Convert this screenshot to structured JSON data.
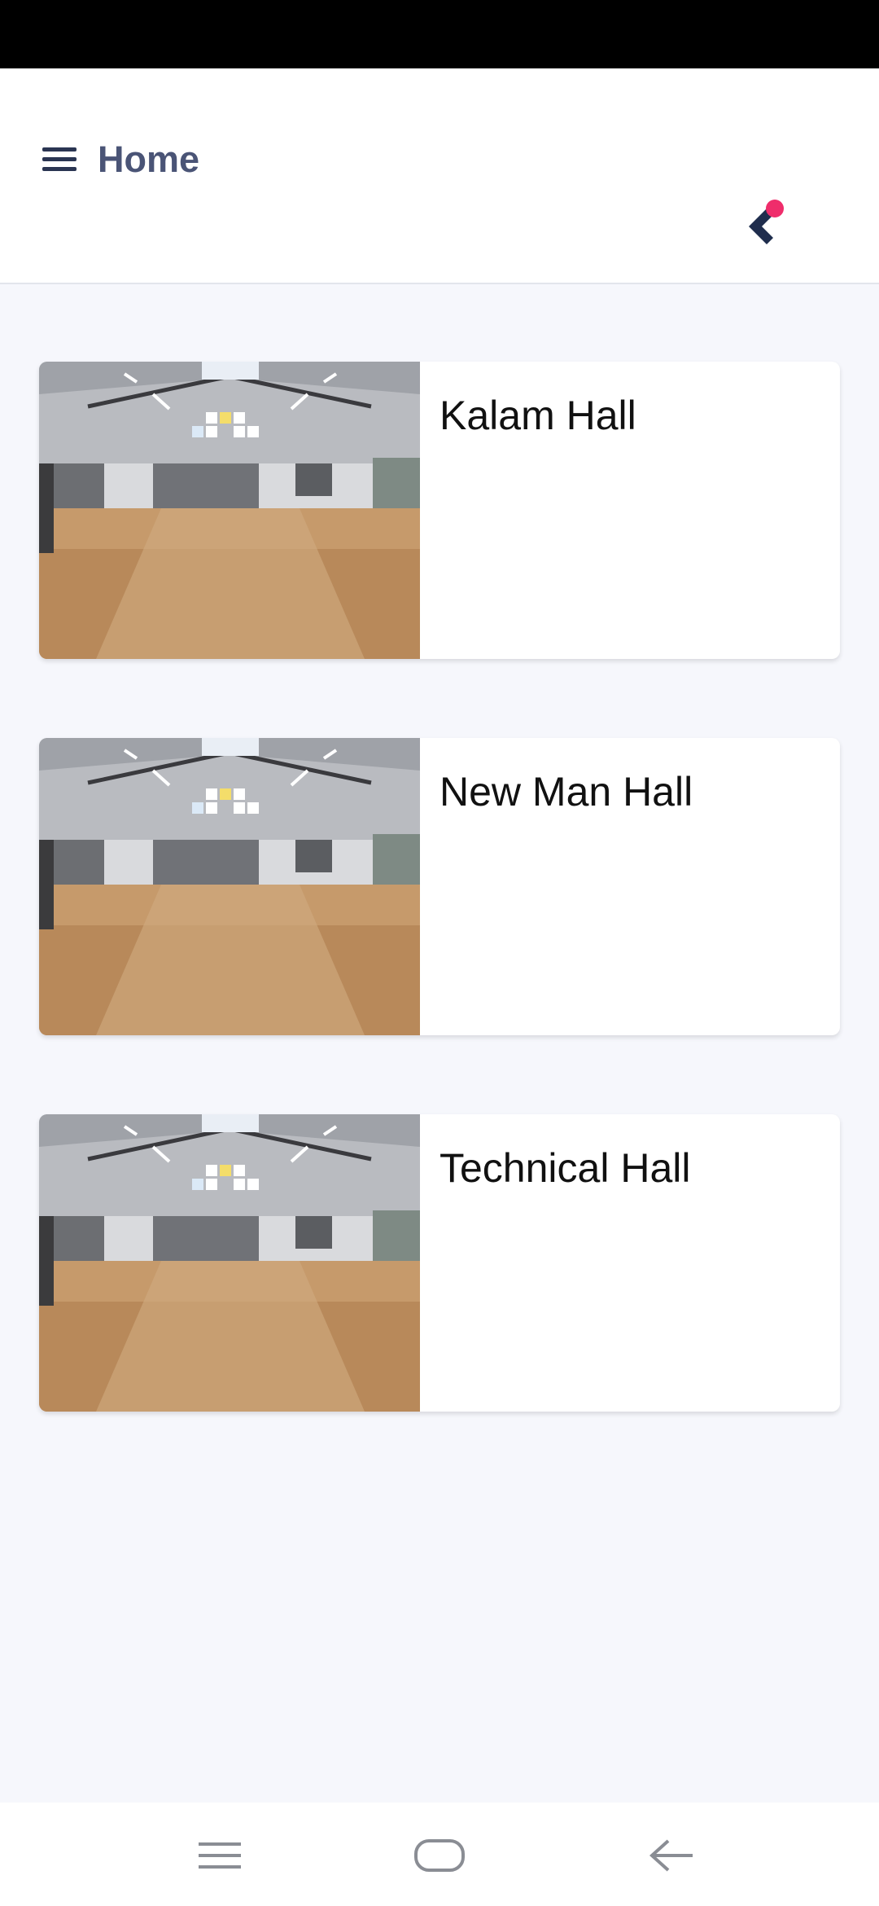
{
  "header": {
    "title": "Home",
    "menu_icon": "hamburger-menu-icon",
    "logo_icon": "brand-chevron-dot-logo"
  },
  "halls": [
    {
      "name": "Kalam Hall",
      "image": "hall-interior-photo"
    },
    {
      "name": "New Man Hall",
      "image": "hall-interior-photo"
    },
    {
      "name": "Technical Hall",
      "image": "hall-interior-photo"
    }
  ],
  "navigation_bar": {
    "recents_icon": "recents-menu-icon",
    "home_icon": "home-pill-icon",
    "back_icon": "back-arrow-icon"
  },
  "colors": {
    "header_text": "#4a5476",
    "logo_chevron": "#1f2d4d",
    "logo_dot": "#ef2d6b",
    "background": "#f6f7fc"
  }
}
